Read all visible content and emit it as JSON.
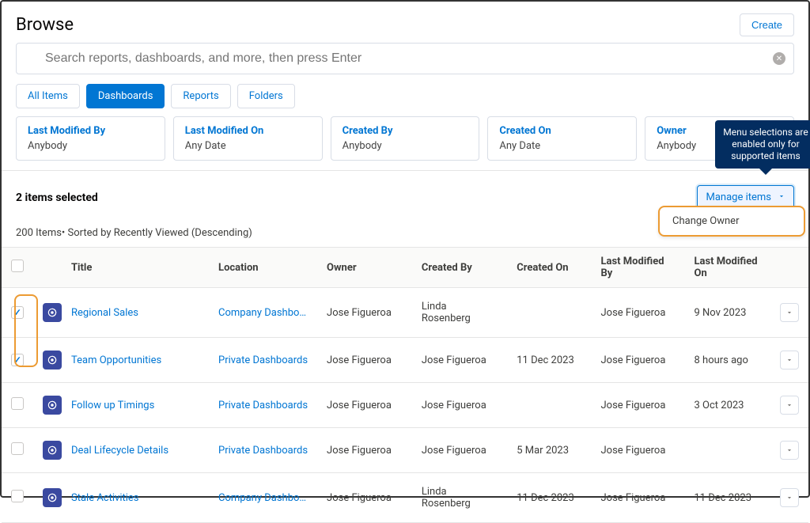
{
  "page": {
    "title": "Browse",
    "create_btn": "Create"
  },
  "search": {
    "placeholder": "Search reports, dashboards, and more, then press Enter"
  },
  "tabs": {
    "all": "All Items",
    "dash": "Dashboards",
    "reports": "Reports",
    "folders": "Folders"
  },
  "filters": [
    {
      "label": "Last Modified By",
      "value": "Anybody"
    },
    {
      "label": "Last Modified On",
      "value": "Any Date"
    },
    {
      "label": "Created By",
      "value": "Anybody"
    },
    {
      "label": "Created On",
      "value": "Any Date"
    },
    {
      "label": "Owner",
      "value": "Anybody"
    }
  ],
  "selection": {
    "text": "2 items selected",
    "manage_btn": "Manage items",
    "tooltip": "Menu selections are enabled only for supported items",
    "menu_item": "Change Owner"
  },
  "sort_note": "200 Items• Sorted by Recently Viewed (Descending)",
  "columns": {
    "title": "Title",
    "location": "Location",
    "owner": "Owner",
    "created_by": "Created By",
    "created_on": "Created On",
    "last_modified_by": "Last Modified By",
    "last_modified_on": "Last Modified On"
  },
  "rows": [
    {
      "checked": true,
      "title": "Regional Sales",
      "location": "Company Dashbo…",
      "owner": "Jose Figueroa",
      "created_by": "Linda Rosenberg",
      "created_on": "",
      "last_modified_by": "Jose Figueroa",
      "last_modified_on": "9 Nov 2023"
    },
    {
      "checked": true,
      "title": "Team Opportunities",
      "location": "Private Dashboards",
      "owner": "Jose Figueroa",
      "created_by": "Jose Figueroa",
      "created_on": "11 Dec 2023",
      "last_modified_by": "Jose Figueroa",
      "last_modified_on": "8 hours ago"
    },
    {
      "checked": false,
      "title": "Follow up Timings",
      "location": "Private Dashboards",
      "owner": "Jose Figueroa",
      "created_by": "Jose Figueroa",
      "created_on": "",
      "last_modified_by": "Jose Figueroa",
      "last_modified_on": "3 Oct 2023"
    },
    {
      "checked": false,
      "title": "Deal Lifecycle Details",
      "location": "Private Dashboards",
      "owner": "Jose Figueroa",
      "created_by": "Jose Figueroa",
      "created_on": "5 Mar 2023",
      "last_modified_by": "Jose Figueroa",
      "last_modified_on": ""
    },
    {
      "checked": false,
      "title": "Stale Activities",
      "location": "Company Dashbo…",
      "owner": "Jose Figueroa",
      "created_by": "Linda Rosenberg",
      "created_on": "11 Dec 2023",
      "last_modified_by": "Jose Figueroa",
      "last_modified_on": "11 Dec 2023"
    }
  ]
}
